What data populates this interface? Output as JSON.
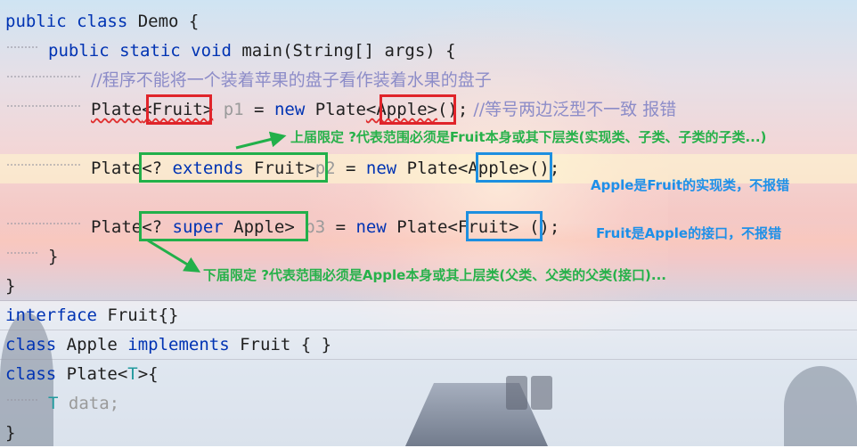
{
  "code": {
    "line1": {
      "kw": "public class",
      "rest": " Demo {"
    },
    "line2": {
      "kw1": "public static void",
      "name": " main",
      "rest": "(String[] args) {"
    },
    "line3": {
      "comment": "//程序不能将一个装着苹果的盘子看作装着水果的盘子"
    },
    "line4": {
      "plate": "Plate",
      "generic": "<Fruit>",
      "var": " p1",
      "eq": " = ",
      "new": "new",
      "plate2": " Plate",
      "generic2": "<Apple>",
      "end": "();",
      "comment": " //等号两边泛型不一致 报错"
    },
    "line5": {
      "plate": "Plate",
      "open": "<? ",
      "extends": "extends",
      "type": " Fruit>",
      "var": "p2",
      "eq": " = ",
      "new": "new",
      "plate2": " Plate",
      "generic2": "<Apple>",
      "end": "();"
    },
    "line6": {
      "plate": "Plate",
      "open": "<? ",
      "super": "super",
      "type": " Apple>",
      "var": " p3",
      "eq": " = ",
      "new": "new",
      "plate2": " Plate",
      "generic2": "<Fruit>",
      "end": " ();"
    },
    "line7": "}",
    "line8": "}",
    "line9": {
      "kw": "interface",
      "rest": " Fruit{}"
    },
    "line10": {
      "kw": "class",
      "name": " Apple ",
      "kw2": "implements",
      "rest": " Fruit { }"
    },
    "line11": {
      "kw": "class",
      "rest": " Plate<",
      "tp": "T",
      "end": ">{"
    },
    "line12": {
      "tp": "T",
      "rest": " data;"
    },
    "line13": "}"
  },
  "annotations": {
    "upper": "上届限定 ?代表范围必须是Fruit本身或其下层类(实现类、子类、子类的子类...)",
    "apple_impl": "Apple是Fruit的实现类，不报错",
    "fruit_iface": "Fruit是Apple的接口，不报错",
    "lower": "下届限定 ?代表范围必须是Apple本身或其上层类(父类、父类的父类(接口)..."
  },
  "colors": {
    "keyword": "#0033b3",
    "comment": "#8c8cc8",
    "type_param": "#20999d",
    "red_box": "#e0242a",
    "green_box": "#22b04a",
    "blue_box": "#1d8fe0"
  }
}
